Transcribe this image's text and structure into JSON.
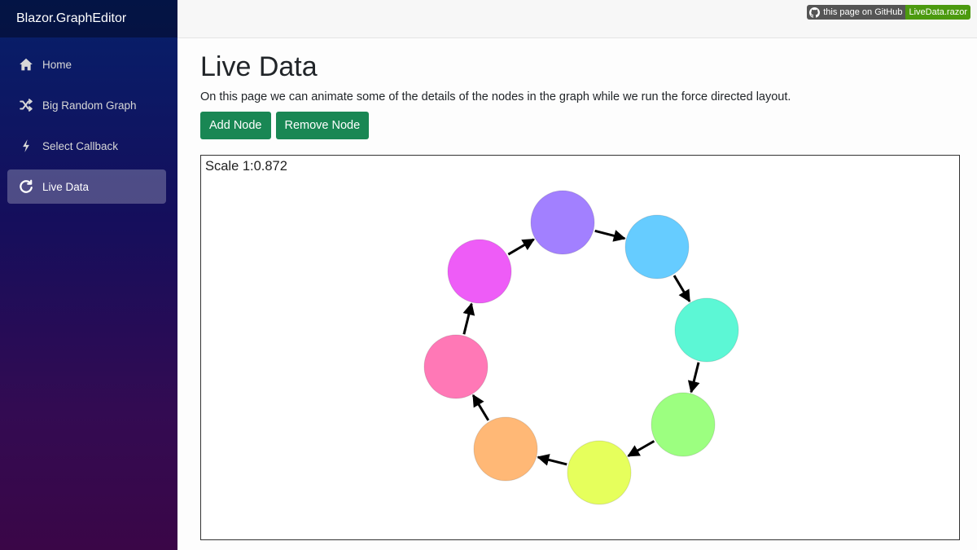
{
  "sidebar": {
    "brand": "Blazor.GraphEditor",
    "items": [
      {
        "label": "Home",
        "icon": "home-icon"
      },
      {
        "label": "Big Random Graph",
        "icon": "shuffle-icon"
      },
      {
        "label": "Select Callback",
        "icon": "lightning-icon"
      },
      {
        "label": "Live Data",
        "icon": "refresh-icon",
        "active": true
      }
    ]
  },
  "topbar": {
    "github_label": "this page on GitHub",
    "file_label": "LiveData.razor"
  },
  "main": {
    "title": "Live Data",
    "description": "On this page we can animate some of the details of the nodes in the graph while we run the force directed layout.",
    "add_button": "Add Node",
    "remove_button": "Remove Node"
  },
  "graph": {
    "scale_label": "Scale 1:0.872",
    "nodes": [
      {
        "id": "purple",
        "color": "#a280ff"
      },
      {
        "id": "blue",
        "color": "#66ccff"
      },
      {
        "id": "teal",
        "color": "#5cf7d5"
      },
      {
        "id": "green",
        "color": "#9cff80"
      },
      {
        "id": "yellow",
        "color": "#e6ff5c"
      },
      {
        "id": "orange",
        "color": "#ffb876"
      },
      {
        "id": "pink",
        "color": "#ff78b6"
      },
      {
        "id": "magenta",
        "color": "#ee5cf7"
      }
    ],
    "edges": [
      [
        "purple",
        "blue"
      ],
      [
        "blue",
        "teal"
      ],
      [
        "teal",
        "green"
      ],
      [
        "green",
        "yellow"
      ],
      [
        "yellow",
        "orange"
      ],
      [
        "orange",
        "pink"
      ],
      [
        "pink",
        "magenta"
      ],
      [
        "magenta",
        "purple"
      ]
    ]
  }
}
